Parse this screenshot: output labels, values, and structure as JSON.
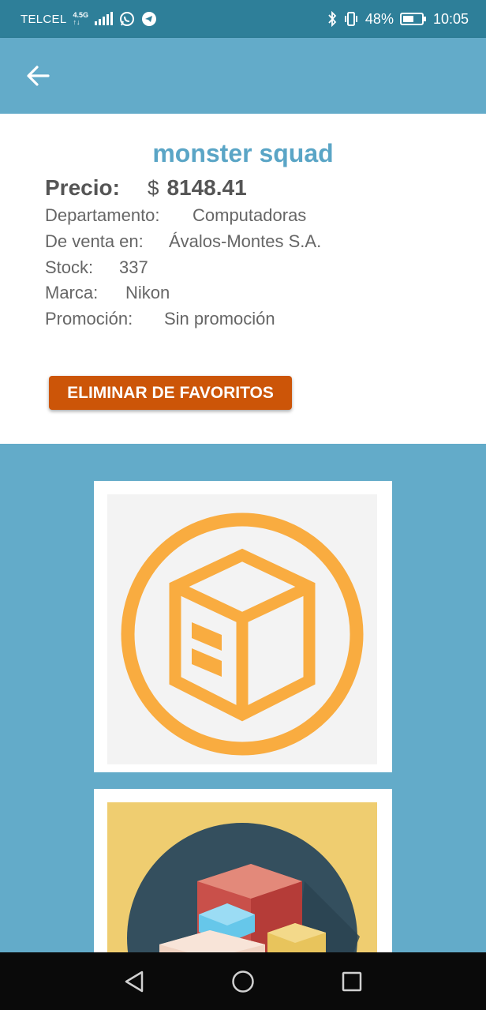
{
  "status_bar": {
    "carrier": "TELCEL",
    "network_top": "4.5G",
    "network_bottom": "↑↓",
    "battery": "48%",
    "time": "10:05"
  },
  "app_bar": {
    "back_icon": "arrow-left-icon"
  },
  "product": {
    "title": "monster squad",
    "price_label": "Precio:",
    "currency": "$",
    "price": "8148.41",
    "department_label": "Departamento:",
    "department": "Computadoras",
    "seller_label": "De venta en:",
    "seller": "Ávalos-Montes S.A.",
    "stock_label": "Stock:",
    "stock": "337",
    "brand_label": "Marca:",
    "brand": "Nikon",
    "promo_label": "Promoción:",
    "promo": "Sin promoción",
    "remove_button": "ELIMINAR DE FAVORITOS"
  },
  "colors": {
    "status_bar": "#2e7f99",
    "app_bar": "#63abc9",
    "title": "#5aa5c6",
    "button": "#cc5508",
    "box_icon": "#f9ac40",
    "card2_bg": "#efcd70",
    "card2_circle": "#344f5e"
  },
  "images": [
    {
      "icon": "box-icon"
    },
    {
      "icon": "stacked-boxes-icon"
    }
  ],
  "nav": {
    "back": "triangle-back-icon",
    "home": "circle-home-icon",
    "recents": "square-recents-icon"
  }
}
